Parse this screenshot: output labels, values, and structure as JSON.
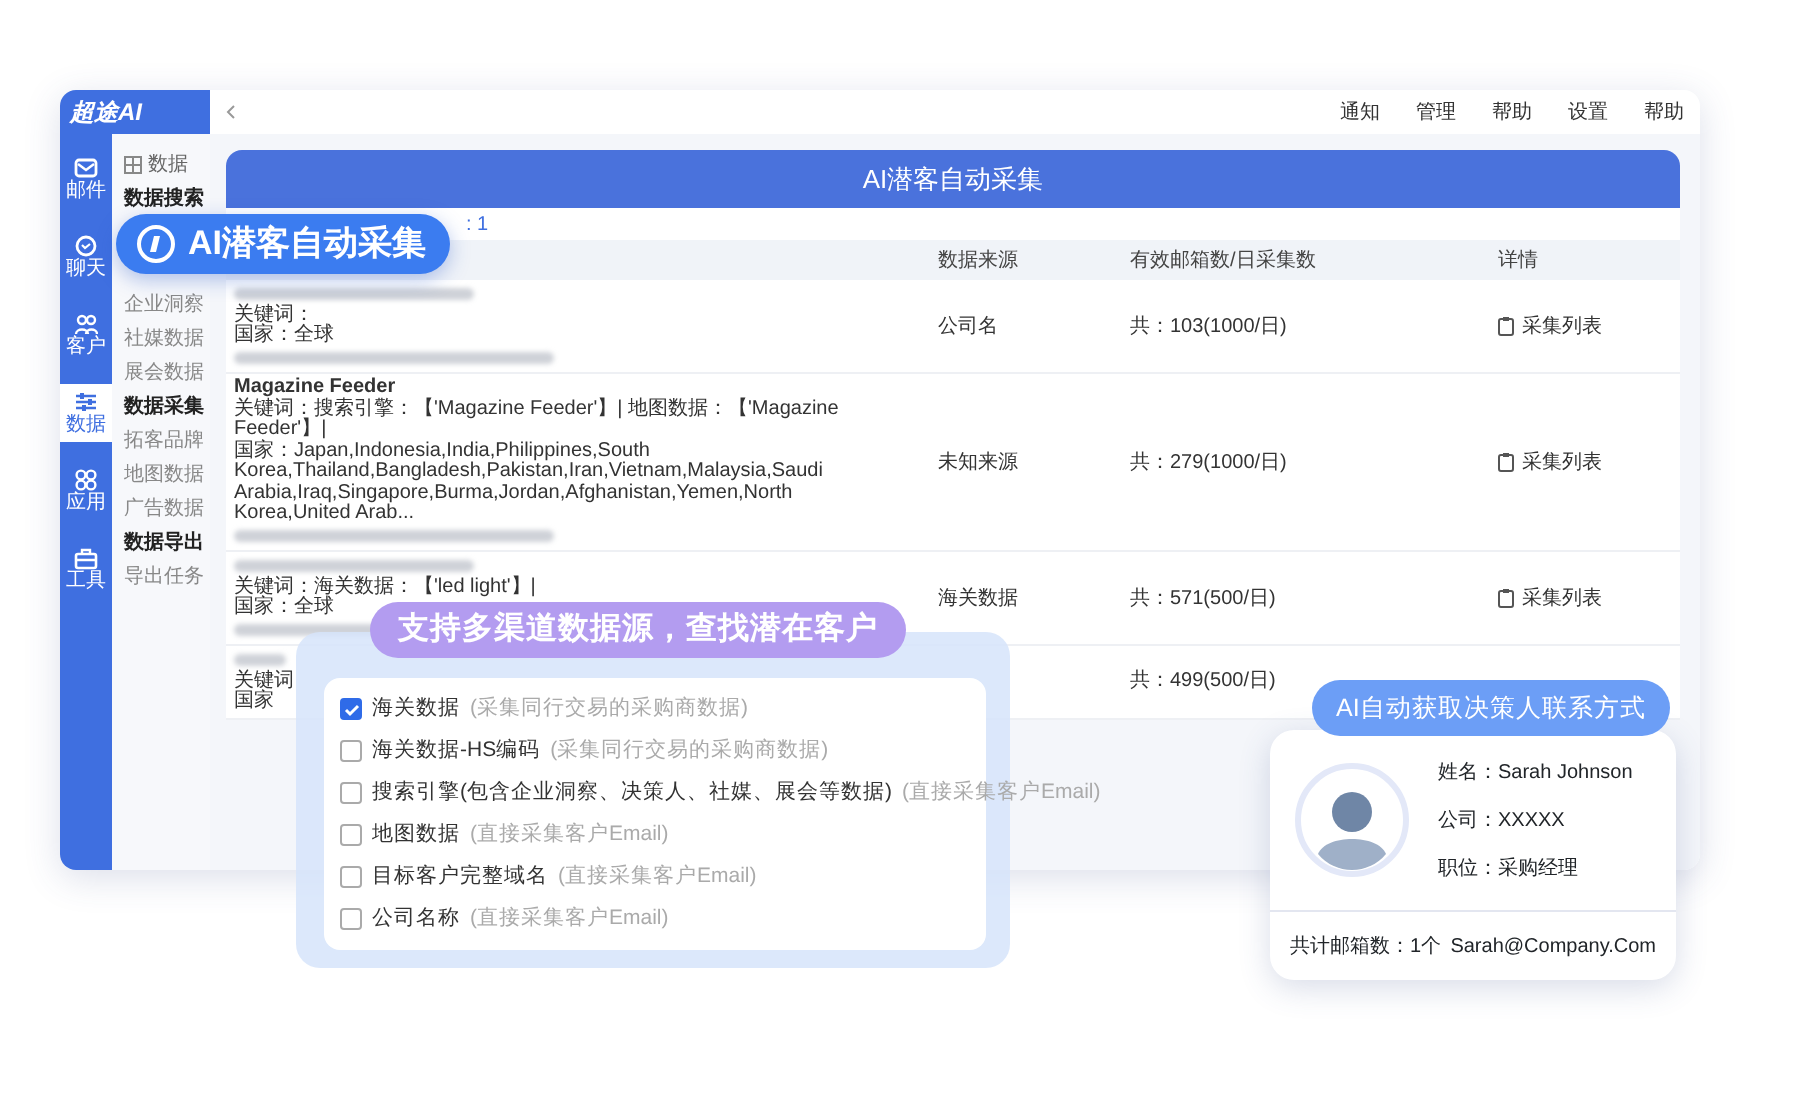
{
  "app": {
    "logo": "超途AI",
    "top_links": [
      "通知",
      "管理",
      "帮助",
      "设置",
      "帮助"
    ],
    "nav_rail": [
      {
        "label": "邮件",
        "selected": false
      },
      {
        "label": "聊天",
        "selected": false
      },
      {
        "label": "客户",
        "selected": false
      },
      {
        "label": "数据",
        "selected": true
      },
      {
        "label": "应用",
        "selected": false
      },
      {
        "label": "工具",
        "selected": false
      }
    ],
    "menu": {
      "title": "数据",
      "items": [
        {
          "label": "数据搜索",
          "kind": "heading"
        },
        {
          "label": "企业洞察",
          "kind": "link"
        },
        {
          "label": "社媒数据",
          "kind": "link"
        },
        {
          "label": "展会数据",
          "kind": "link"
        },
        {
          "label": "数据采集",
          "kind": "heading"
        },
        {
          "label": "拓客品牌",
          "kind": "link"
        },
        {
          "label": "地图数据",
          "kind": "link"
        },
        {
          "label": "广告数据",
          "kind": "link"
        },
        {
          "label": "数据导出",
          "kind": "heading"
        },
        {
          "label": "导出任务",
          "kind": "link"
        }
      ]
    },
    "banner": "AI潜客自动采集",
    "count": ": 1",
    "table": {
      "columns": [
        "数据来源",
        "有效邮箱数/日采集数",
        "详情"
      ],
      "rows": [
        {
          "redacted": true,
          "keywords": "关键词：",
          "country": "国家：全球",
          "source": "公司名",
          "emails": "共：103(1000/日)",
          "detail": "采集列表"
        },
        {
          "title": "Magazine Feeder",
          "keywords": "关键词：搜索引擎：【'Magazine Feeder'】| 地图数据：【'Magazine Feeder'】|",
          "country": "国家：Japan,Indonesia,India,Philippines,South Korea,Thailand,Bangladesh,Pakistan,Iran,Vietnam,Malaysia,Saudi Arabia,Iraq,Singapore,Burma,Jordan,Afghanistan,Yemen,North Korea,United Arab...",
          "source": "未知来源",
          "emails": "共：279(1000/日)",
          "detail": "采集列表"
        },
        {
          "redacted": true,
          "keywords": "关键词：海关数据：【'led light'】|",
          "country": "国家：全球",
          "source": "海关数据",
          "emails": "共：571(500/日)",
          "detail": "采集列表"
        },
        {
          "redacted": true,
          "keywords": "关键词",
          "country": "国家",
          "emails": "共：499(500/日)"
        }
      ]
    }
  },
  "feature_badge": "AI潜客自动采集",
  "sources": {
    "badge": "支持多渠道数据源，查找潜在客户",
    "options": [
      {
        "label": "海关数据",
        "hint": "(采集同行交易的采购商数据)",
        "checked": true
      },
      {
        "label": "海关数据-HS编码",
        "hint": "(采集同行交易的采购商数据)",
        "checked": false
      },
      {
        "label": "搜索引擎(包含企业洞察、决策人、社媒、展会等数据)",
        "hint": "(直接采集客户Email)",
        "checked": false
      },
      {
        "label": "地图数据",
        "hint": "(直接采集客户Email)",
        "checked": false
      },
      {
        "label": "目标客户完整域名",
        "hint": "(直接采集客户Email)",
        "checked": false
      },
      {
        "label": "公司名称",
        "hint": "(直接采集客户Email)",
        "checked": false
      }
    ]
  },
  "contact": {
    "badge": "AI自动获取决策人联系方式",
    "fields": [
      "姓名：Sarah Johnson",
      "公司：XXXXX",
      "职位：采购经理"
    ],
    "total": "共计邮箱数：1个",
    "email": "Sarah@Company.Com"
  }
}
